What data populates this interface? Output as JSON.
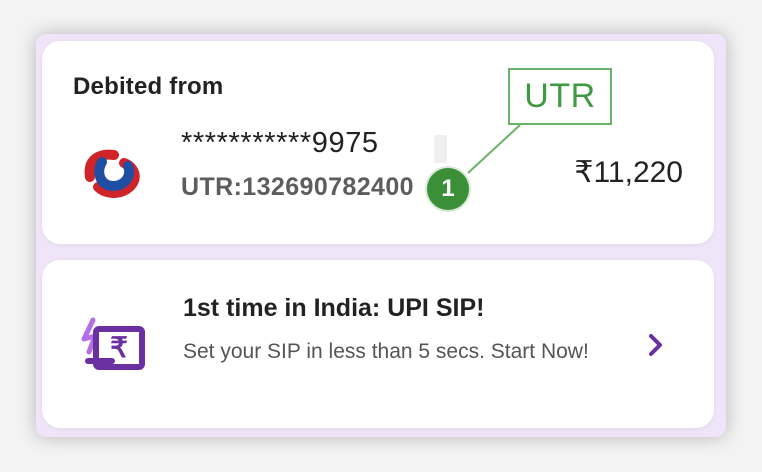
{
  "debit_card": {
    "title": "Debited from",
    "account_number": "***********9975",
    "utr": "UTR:132690782400",
    "amount": "₹11,220"
  },
  "annotation": {
    "label": "UTR",
    "marker_number": "1"
  },
  "promo_card": {
    "title": "1st time in India: UPI SIP!",
    "subtitle": "Set your SIP in less than 5 secs. Start Now!"
  },
  "icons": {
    "bank": "bank-logo-icon",
    "promo": "rupee-wallet-lightning-icon",
    "next": "chevron-right-icon"
  },
  "colors": {
    "background": "#f3f3f3",
    "panel": "#efe4f8",
    "card": "#ffffff",
    "annotation_green": "#3f9a43",
    "marker_green": "#3a8f37",
    "promo_purple": "#6a2fa0",
    "bank_red": "#d0242b",
    "bank_blue": "#1f4ea3"
  }
}
